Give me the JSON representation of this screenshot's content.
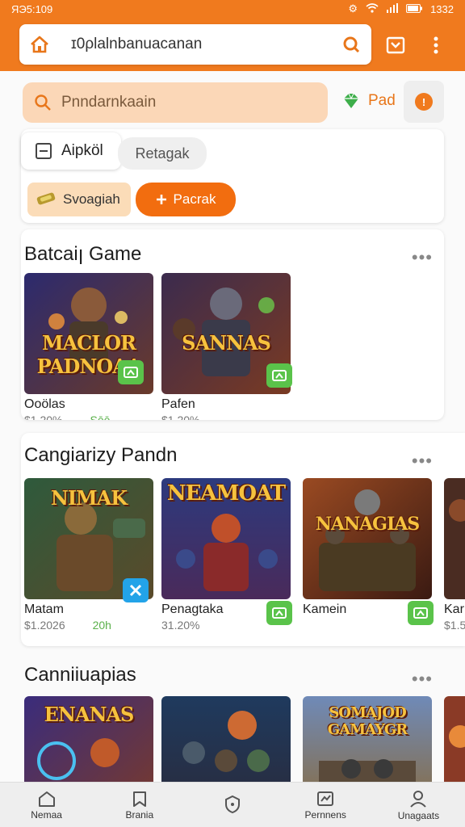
{
  "status": {
    "time": "ЯЭ5:109",
    "clock": "1332"
  },
  "browser": {
    "url": "ɪ0ρlalnbanuacanan"
  },
  "search": {
    "placeholder": "Pnndarnkaain"
  },
  "header_action": {
    "label": "Pad",
    "alert_glyph": "!"
  },
  "chips": {
    "primary": "Aipköl",
    "secondary": "Retagak",
    "tertiary": "Svoagiah",
    "accent": "Pacrak"
  },
  "sections": [
    {
      "title": "Batcaiꞁ Game",
      "tiles": [
        {
          "art_title": "MACLOR PADNOAA",
          "name": "Ooölas",
          "rating": "$1.20%",
          "extra": "Sōō",
          "badge": "green",
          "scene": "#4a3a8a",
          "accent": "#e98f3a"
        },
        {
          "art_title": "SANNAS",
          "name": "Pafen",
          "rating": "$1.20%",
          "extra": "",
          "badge": "green",
          "scene": "#3b2b4e",
          "accent": "#b8762f"
        }
      ]
    },
    {
      "title": "Cangiarizy Pandn",
      "tiles": [
        {
          "art_title": "NIMAK",
          "name": "Matam",
          "rating": "$1.2026",
          "extra": "20h",
          "badge": "blue",
          "scene": "#2e5a3c",
          "accent": "#d8a03a"
        },
        {
          "art_title": "NEAMOAT",
          "name": "Penagtaka",
          "rating": "31.20%",
          "extra": "",
          "badge": "green",
          "scene": "#2c3a7e",
          "accent": "#e8a03a"
        },
        {
          "art_title": "NANAGIAS",
          "name": "Kamein",
          "rating": "",
          "extra": "",
          "badge": "green",
          "scene": "#7a3222",
          "accent": "#e07a2a"
        },
        {
          "art_title": "",
          "name": "Kar",
          "rating": "$1.5",
          "extra": "",
          "badge": "",
          "scene": "#4a2c22",
          "accent": "#c06030"
        }
      ]
    },
    {
      "title": "Canniiuapias",
      "tiles": [
        {
          "art_title": "ENANAS",
          "name": "",
          "rating": "",
          "extra": "",
          "badge": "",
          "scene": "#3a2c7c",
          "accent": "#e88a3a"
        },
        {
          "art_title": "",
          "name": "",
          "rating": "",
          "extra": "",
          "badge": "",
          "scene": "#1f3a5e",
          "accent": "#e07030"
        },
        {
          "art_title": "SOMAJOD GAMAYGR",
          "name": "",
          "rating": "",
          "extra": "",
          "badge": "",
          "scene": "#6f8ab8",
          "accent": "#d8a040"
        },
        {
          "art_title": "",
          "name": "",
          "rating": "",
          "extra": "",
          "badge": "",
          "scene": "#8a3a26",
          "accent": "#e88a3a"
        }
      ]
    }
  ],
  "bottom_nav": [
    "Nemaa",
    "Brania",
    "",
    "Pernnens",
    "Unagaats"
  ],
  "colors": {
    "brand": "#f07a1e",
    "accent_green": "#5ac34a",
    "accent_blue": "#23a3e8"
  }
}
